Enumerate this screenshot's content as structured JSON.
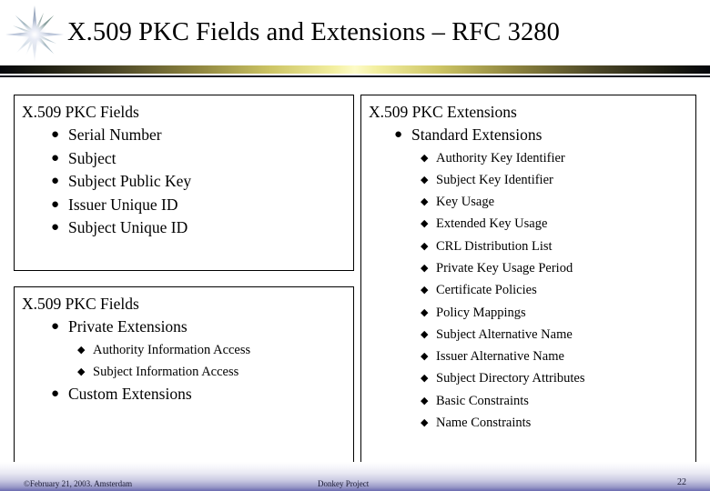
{
  "header": {
    "title": "X.509 PKC Fields and Extensions – RFC 3280",
    "star_icon": "starburst-icon",
    "rule_gradient_center": "#fdfbc8",
    "rule_gradient_edge": "#05070c"
  },
  "boxes": {
    "fields": {
      "heading": "X.509 PKC Fields",
      "items": [
        {
          "label": "Serial Number",
          "bullet": "disc"
        },
        {
          "label": "Subject",
          "bullet": "disc"
        },
        {
          "label": "Subject Public Key",
          "bullet": "disc"
        },
        {
          "label": "Issuer Unique ID",
          "bullet": "disc"
        },
        {
          "label": "Subject Unique ID",
          "bullet": "disc"
        }
      ]
    },
    "private": {
      "heading": "X.509 PKC Fields",
      "items": [
        {
          "label": "Private Extensions",
          "bullet": "disc",
          "children": [
            {
              "label": "Authority Information Access",
              "bullet": "diamond"
            },
            {
              "label": "Subject Information Access",
              "bullet": "diamond"
            }
          ]
        },
        {
          "label": "Custom Extensions",
          "bullet": "disc"
        }
      ]
    },
    "extensions": {
      "heading": "X.509 PKC Extensions",
      "items": [
        {
          "label": "Standard Extensions",
          "bullet": "disc",
          "children": [
            {
              "label": "Authority Key Identifier",
              "bullet": "diamond"
            },
            {
              "label": "Subject Key Identifier",
              "bullet": "diamond"
            },
            {
              "label": "Key Usage",
              "bullet": "diamond"
            },
            {
              "label": "Extended Key Usage",
              "bullet": "diamond"
            },
            {
              "label": "CRL Distribution List",
              "bullet": "diamond"
            },
            {
              "label": "Private Key Usage Period",
              "bullet": "diamond"
            },
            {
              "label": "Certificate Policies",
              "bullet": "diamond"
            },
            {
              "label": "Policy Mappings",
              "bullet": "diamond"
            },
            {
              "label": "Subject Alternative Name",
              "bullet": "diamond"
            },
            {
              "label": "Issuer Alternative Name",
              "bullet": "diamond"
            },
            {
              "label": "Subject Directory Attributes",
              "bullet": "diamond"
            },
            {
              "label": "Basic Constraints",
              "bullet": "diamond"
            },
            {
              "label": "Name Constraints",
              "bullet": "diamond"
            }
          ]
        }
      ]
    }
  },
  "footer": {
    "copyright": "©February 21, 2003. Amsterdam",
    "project": "Donkey Project",
    "page_number": "22"
  },
  "glyphs": {
    "disc": "●",
    "diamond": "◆"
  }
}
